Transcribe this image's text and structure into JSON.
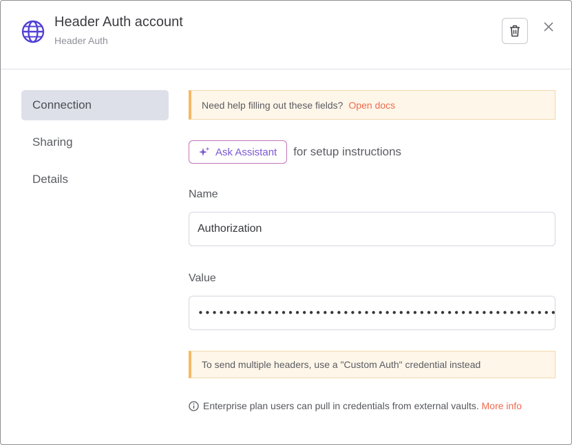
{
  "header": {
    "title": "Header Auth account",
    "subtitle": "Header Auth",
    "icon": "globe-icon",
    "delete_icon": "trash-icon",
    "close_icon": "close-icon"
  },
  "sidebar": {
    "items": [
      {
        "label": "Connection",
        "active": true
      },
      {
        "label": "Sharing",
        "active": false
      },
      {
        "label": "Details",
        "active": false
      }
    ]
  },
  "main": {
    "help_callout": {
      "text": "Need help filling out these fields?",
      "link": "Open docs"
    },
    "assistant": {
      "button_label": "Ask Assistant",
      "suffix": "for setup instructions"
    },
    "name_field": {
      "label": "Name",
      "value": "Authorization"
    },
    "value_field": {
      "label": "Value",
      "masked_value": "••••••••••••••••••••••••••••••••••••••••••••••••••••••••"
    },
    "headers_callout": {
      "text": "To send multiple headers, use a \"Custom Auth\" credential instead"
    },
    "info": {
      "text": "Enterprise plan users can pull in credentials from external vaults.",
      "link": "More info"
    }
  },
  "colors": {
    "accent_link": "#ef6a4e",
    "assistant_text": "#7b58d1",
    "globe": "#5140d6",
    "callout_border": "#f4b963"
  }
}
